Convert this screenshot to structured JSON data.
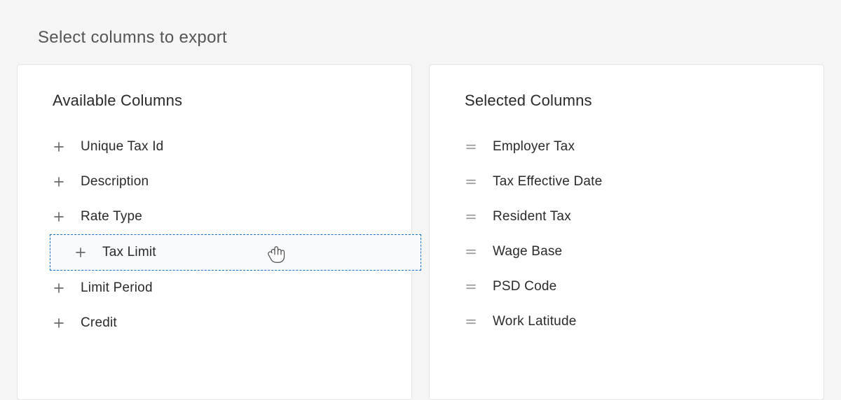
{
  "title": "Select columns to export",
  "available": {
    "heading": "Available Columns",
    "items": [
      {
        "label": "Unique Tax Id",
        "dragging": false
      },
      {
        "label": "Description",
        "dragging": false
      },
      {
        "label": "Rate Type",
        "dragging": false
      },
      {
        "label": "Tax Limit",
        "dragging": true
      },
      {
        "label": "Limit Period",
        "dragging": false
      },
      {
        "label": "Credit",
        "dragging": false
      }
    ]
  },
  "selected": {
    "heading": "Selected Columns",
    "items": [
      {
        "label": "Employer Tax"
      },
      {
        "label": "Tax Effective Date"
      },
      {
        "label": "Resident Tax"
      },
      {
        "label": "Wage Base"
      },
      {
        "label": "PSD Code"
      },
      {
        "label": "Work Latitude"
      }
    ]
  }
}
